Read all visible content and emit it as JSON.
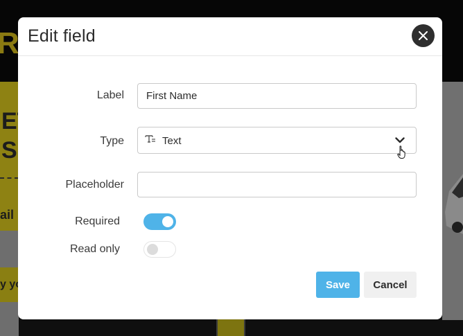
{
  "background": {
    "logo_letter": "R",
    "heading_line1": "ET",
    "heading_line2": "S",
    "email_fragment": "ail",
    "pill_fragment": "y yo"
  },
  "modal": {
    "title": "Edit field",
    "close_icon": "close-icon",
    "fields": {
      "label": {
        "label": "Label",
        "value": "First Name"
      },
      "type": {
        "label": "Type",
        "value": "Text",
        "icon": "text-field-icon"
      },
      "placeholder": {
        "label": "Placeholder",
        "value": "",
        "placeholder": ""
      },
      "required": {
        "label": "Required",
        "on": true
      },
      "read_only": {
        "label": "Read only",
        "on": false
      }
    },
    "buttons": {
      "save": "Save",
      "cancel": "Cancel"
    }
  },
  "colors": {
    "accent": "#4fb3e8",
    "close_bg": "#2e2e2e",
    "overlay_dark": "#0f0f0f",
    "brand_yellow_dimmed": "#8e8213"
  }
}
